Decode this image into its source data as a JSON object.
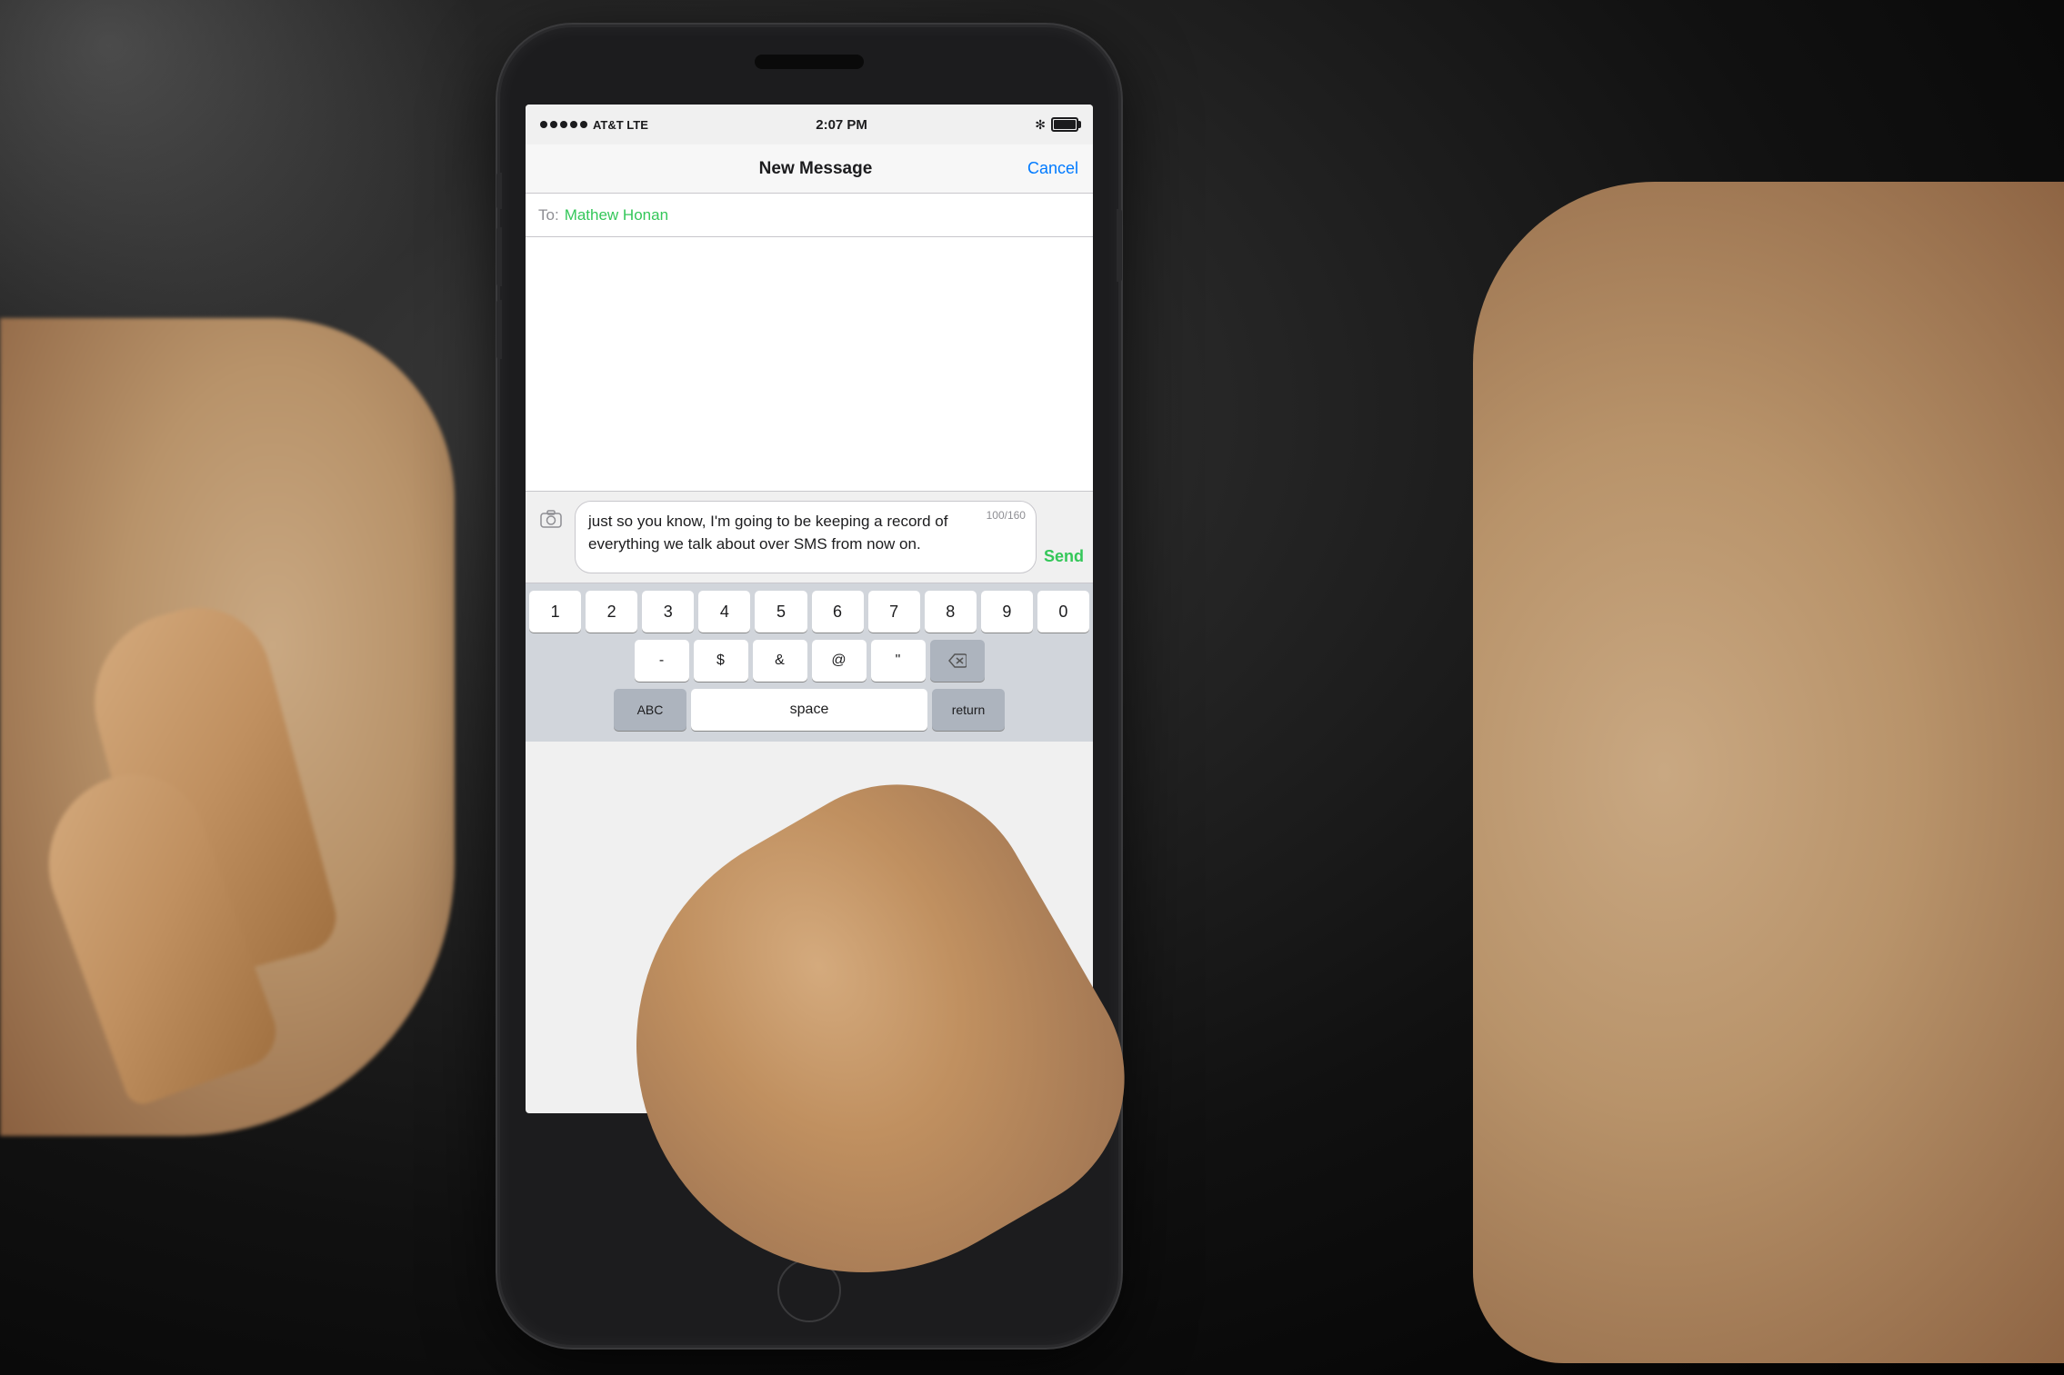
{
  "background": {
    "color": "#111111"
  },
  "phone": {
    "status_bar": {
      "signal_dots": 5,
      "carrier": "AT&T LTE",
      "time": "2:07 PM",
      "bluetooth": "✻",
      "battery_level": "full"
    },
    "nav_bar": {
      "title": "New Message",
      "cancel_label": "Cancel"
    },
    "to_field": {
      "label": "To:",
      "recipient": "Mathew Honan"
    },
    "message": {
      "text": "just so you know, I'm going to be keeping a record of everything we talk about over SMS from now on.",
      "char_count": "100/160",
      "send_label": "Send"
    },
    "keyboard": {
      "row1": [
        "1",
        "2",
        "3",
        "4",
        "5",
        "6",
        "7",
        "8",
        "9",
        "0"
      ],
      "row2": [
        "-",
        "$",
        "&",
        "@",
        "\""
      ],
      "row3_special_left": "ABC",
      "row3_space": "space",
      "row3_delete": "⌫",
      "bottom_bar": {
        "abc": "ABC",
        "delete": "⌫"
      }
    }
  }
}
